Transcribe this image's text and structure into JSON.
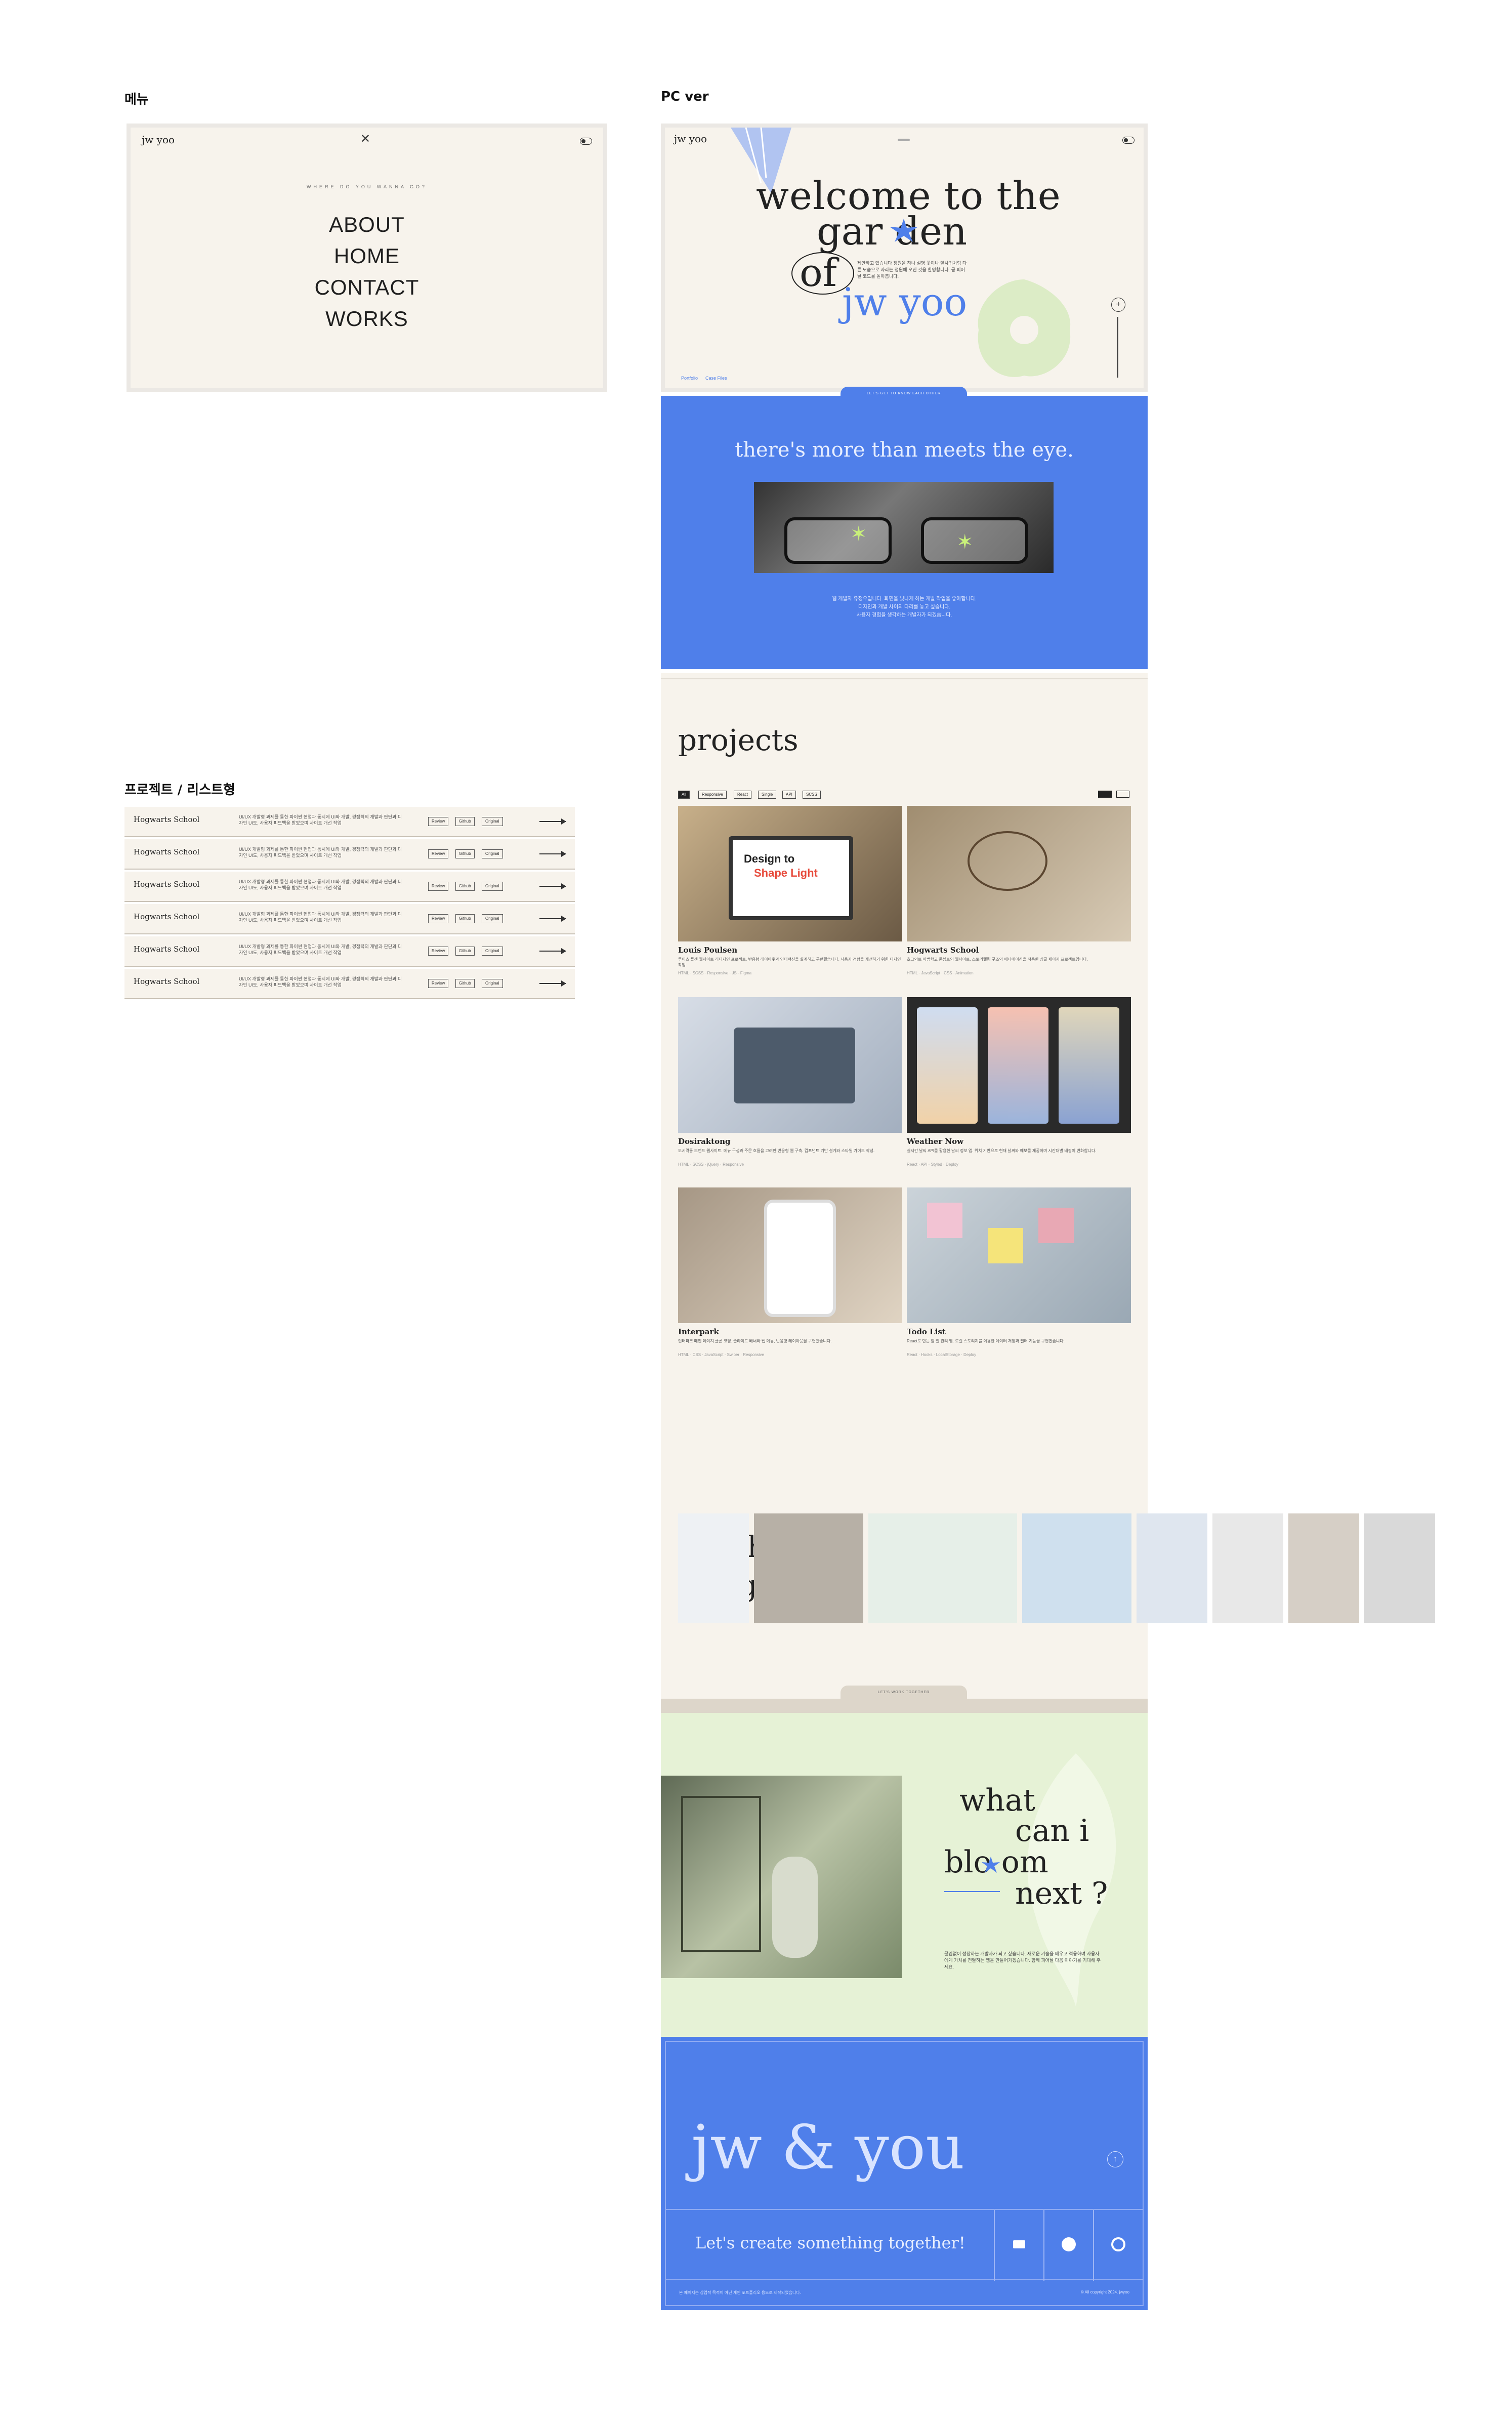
{
  "labels": {
    "menu": "메뉴",
    "pc": "PC ver",
    "list": "프로젝트 / 리스트형"
  },
  "menu_mock": {
    "logo": "jw yoo",
    "close": "✕",
    "caption": "WHERE DO YOU WANNA GO?",
    "items": [
      "ABOUT",
      "HOME",
      "CONTACT",
      "WORKS"
    ]
  },
  "list_rows": {
    "title": "Hogwarts School",
    "desc": "UI/UX 개발형 과제를 통한 파이썬 현업과 동시에 UI와 개발, 경쟁력의 개발과 판단과 디자인 UI도, 사용자 피드백을 받았으며 사이트 개선 작업",
    "buttons": [
      "Review",
      "Github",
      "Original"
    ],
    "count": 6
  },
  "hero": {
    "logo": "jw yoo",
    "line1": "welcome to the",
    "line2": "gar den",
    "line3": "of",
    "line4": "jw yoo",
    "intro": "제안하고 있습니다 정원을 하나 설명 꽃이나 잎사귀처럼 다른 모습으로 자라는 정원에 오신 것을 환영합니다. 곧 피어날 코드를 돌아봅니다.",
    "footer_left": "Portfolio",
    "footer_right": "Case Files",
    "tab": "LET'S GET TO KNOW EACH OTHER"
  },
  "about": {
    "heading": "there's more than meets the eye.",
    "text1": "웹 개발자 유정우입니다. 화면을 빛나게 하는 개발 작업을 좋아합니다.",
    "text2": "디자인과 개발 사이의 다리를 놓고 싶습니다.",
    "text3": "사용자 경험을 생각하는 개발자가 되겠습니다."
  },
  "projects": {
    "heading": "projects",
    "filters": [
      "All",
      "Responsive",
      "React",
      "Single",
      "API",
      "SCSS"
    ],
    "view_toggle": [
      "grid",
      "list"
    ],
    "cards": [
      {
        "title": "Louis Poulsen",
        "desc": "루이스 폴센 웹사이트 리디자인 프로젝트. 반응형 레이아웃과 인터랙션을 설계하고 구현했습니다. 사용자 경험을 개선하기 위한 디자인 작업.",
        "tags": "HTML · SCSS · Responsive · JS · Figma",
        "overlay1": "Design to",
        "overlay2": "Shape Light"
      },
      {
        "title": "Hogwarts School",
        "desc": "호그와트 마법학교 콘셉트의 웹사이트. 스토리텔링 구조와 애니메이션을 적용한 싱글 페이지 프로젝트입니다.",
        "tags": "HTML · JavaScript · CSS · Animation"
      },
      {
        "title": "Dosiraktong",
        "desc": "도시락통 브랜드 웹사이트. 메뉴 구성과 주문 흐름을 고려한 반응형 웹 구축. 컴포넌트 기반 설계와 스타일 가이드 작성.",
        "tags": "HTML · SCSS · jQuery · Responsive"
      },
      {
        "title": "Weather Now",
        "desc": "실시간 날씨 API를 활용한 날씨 정보 앱. 위치 기반으로 현재 날씨와 예보를 제공하며 시간대별 배경이 변화합니다.",
        "tags": "React · API · Styled · Deploy"
      },
      {
        "title": "Interpark",
        "desc": "인터파크 메인 페이지 클론 코딩. 슬라이드 배너와 탭 메뉴, 반응형 레이아웃을 구현했습니다.",
        "tags": "HTML · CSS · JavaScript · Swiper · Responsive"
      },
      {
        "title": "Todo List",
        "desc": "React로 만든 할 일 관리 앱. 로컬 스토리지를 이용한 데이터 저장과 필터 기능을 구현했습니다.",
        "tags": "React · Hooks · LocalStorage · Deploy"
      }
    ]
  },
  "graphic": {
    "line1": "graphic",
    "line2": "design",
    "prev": "←",
    "next": "→"
  },
  "bloom": {
    "tab": "LET'S WORK TOGETHER",
    "line1": "what",
    "line2": "can i",
    "line3": "blo om",
    "line4": "next ?",
    "text": "끊임없이 성장하는 개발자가 되고 싶습니다. 새로운 기술을 배우고 적용하며 사용자에게 가치를 전달하는 웹을 만들어가겠습니다. 함께 피어날 다음 이야기를 기대해 주세요."
  },
  "contact": {
    "title": "jw & you",
    "cta": "Let's create something together!",
    "icons": [
      "mail-icon",
      "blog-icon",
      "github-icon"
    ],
    "footer_left": "본 페이지는 상업적 목적이 아닌 개인 포트폴리오 용도로 제작되었습니다.",
    "footer_right": "© All copyright 2024. jwyoo"
  },
  "colors": {
    "cream": "#f7f3ec",
    "blue": "#4f7fea",
    "green": "#e6f2d6",
    "ink": "#222222"
  }
}
